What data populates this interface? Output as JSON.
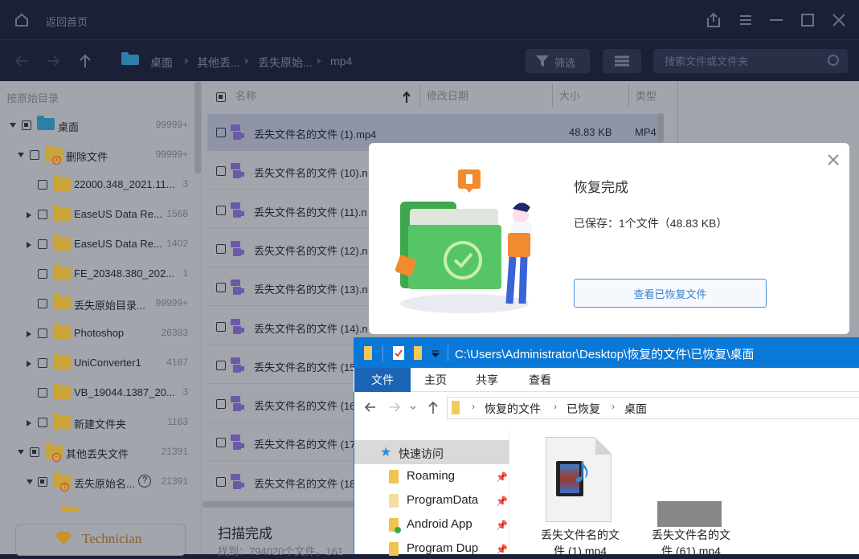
{
  "titlebar": {
    "home_label": "返回首页",
    "icons": [
      "home-icon",
      "share-icon",
      "menu-icon",
      "minimize-icon",
      "maximize-icon",
      "close-icon"
    ]
  },
  "toolbar": {
    "breadcrumb": [
      "桌面",
      "其他丢...",
      "丢失原始...",
      "mp4"
    ],
    "filter_label": "筛选",
    "search_placeholder": "搜索文件或文件夹"
  },
  "sidebar": {
    "title": "按原始目录",
    "tree": [
      {
        "label": "桌面",
        "count": "99999+"
      },
      {
        "label": "删除文件",
        "count": "99999+"
      },
      {
        "label": "22000.348_2021.11...",
        "count": "3"
      },
      {
        "label": "EaseUS Data Re...",
        "count": "1568"
      },
      {
        "label": "EaseUS Data Re...",
        "count": "1402"
      },
      {
        "label": "FE_20348.380_202...",
        "count": "1"
      },
      {
        "label": "丢失原始目录...",
        "count": "99999+"
      },
      {
        "label": "Photoshop",
        "count": "26383"
      },
      {
        "label": "UniConverter1",
        "count": "4187"
      },
      {
        "label": "VB_19044.1387_20...",
        "count": "3"
      },
      {
        "label": "新建文件夹",
        "count": "1163"
      },
      {
        "label": "其他丢失文件",
        "count": "21391"
      },
      {
        "label": "丢失原始名...",
        "count": "21391"
      }
    ],
    "technician_label": "Technician"
  },
  "filelist": {
    "columns": {
      "name": "名称",
      "modified": "修改日期",
      "size": "大小",
      "type": "类型"
    },
    "rows": [
      {
        "name": "丢失文件名的文件 (1).mp4",
        "size": "48.83 KB",
        "type": "MP4"
      },
      {
        "name": "丢失文件名的文件 (10).n",
        "size": "",
        "type": ""
      },
      {
        "name": "丢失文件名的文件 (11).n",
        "size": "",
        "type": ""
      },
      {
        "name": "丢失文件名的文件 (12).n",
        "size": "",
        "type": ""
      },
      {
        "name": "丢失文件名的文件 (13).n",
        "size": "",
        "type": ""
      },
      {
        "name": "丢失文件名的文件 (14).n",
        "size": "",
        "type": ""
      },
      {
        "name": "丢失文件名的文件 (15",
        "size": "",
        "type": ""
      },
      {
        "name": "丢失文件名的文件 (16",
        "size": "",
        "type": ""
      },
      {
        "name": "丢失文件名的文件 (17",
        "size": "",
        "type": ""
      },
      {
        "name": "丢失文件名的文件 (18",
        "size": "",
        "type": ""
      }
    ],
    "scan_title": "扫描完成",
    "scan_sub": "找到：794020个文件，161"
  },
  "dialog": {
    "title": "恢复完成",
    "info": "已保存：1个文件（48.83 KB）",
    "button_label": "查看已恢复文件"
  },
  "explorer": {
    "path": "C:\\Users\\Administrator\\Desktop\\恢复的文件\\已恢复\\桌面",
    "tabs": [
      "文件",
      "主页",
      "共享",
      "查看"
    ],
    "address": [
      "恢复的文件",
      "已恢复",
      "桌面"
    ],
    "quick_access": "快速访问",
    "nav_items": [
      "Roaming",
      "ProgramData",
      "Android App",
      "Program Dup"
    ],
    "files": [
      {
        "line1": "丢失文件名的文",
        "line2": "件 (1).mp4"
      },
      {
        "line1": "丢失文件名的文",
        "line2": "件 (61).mp4"
      }
    ]
  }
}
